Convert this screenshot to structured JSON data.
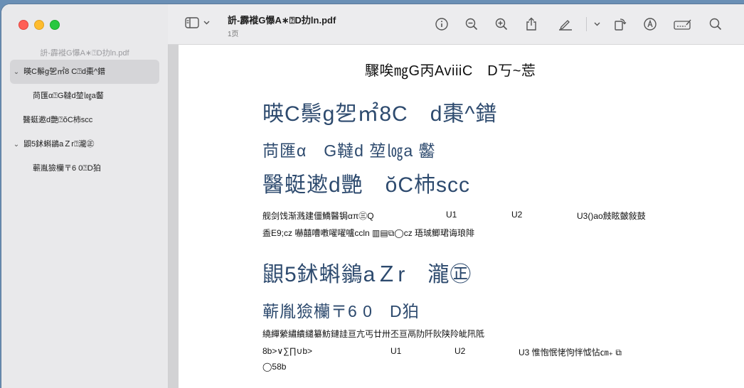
{
  "window": {
    "doc_title": "䛂-霹褷G懪A∗⍰D扐ln.pdf",
    "page_label": "1页"
  },
  "sidebar": {
    "title": "䛂-霹褷G懪A∗⍰D扐ln.pdf",
    "items": [
      {
        "chevron": "⌄",
        "label": "暎C鬃g乫㎡8 C⍰d棗^鐠"
      },
      {
        "chevron": "",
        "label": "苘匯α⍰G韃d堃㏒a齾"
      },
      {
        "chevron": "",
        "label": "醫蜓遬d艷⍰ŏC杮scc"
      },
      {
        "chevron": "⌄",
        "label": "鼰5鉥蝌鶲aＺr⍰瀧㊣"
      },
      {
        "chevron": "",
        "label": "蕲胤獫欗〒6 0⍰D狛"
      }
    ]
  },
  "toolbar": {
    "icons": [
      "sidebar-toggle-icon",
      "info-icon",
      "zoom-out-icon",
      "zoom-in-icon",
      "share-icon",
      "highlight-icon",
      "rotate-icon",
      "markup-icon",
      "form-icon",
      "search-icon"
    ]
  },
  "pdf": {
    "top_line": "驟唉㎎G丙AviiiC　D丂~莣",
    "h1a": "暎C鬃g乫㎡8C　d棗^鐠",
    "h2a": "苘匯α　G韃d 堃㏒a 齾",
    "h1b": "醫蜓遬d艷　ŏC杮scc",
    "para1": {
      "c1": "舰剑饯渐溅建僵鱎醫锔απ㊂Q",
      "c2": "U1",
      "c3": "U2",
      "c4": "U3()ao㩻眩皼敍鼓"
    },
    "para2": "盉E9;cz 嚇囍嘈嘋嚁嚁嚧ccln ▥▤⧉◯cz 珸珹鲫珺诲琅陫",
    "h1c": "鼰5鉥蝌鶲aＺr　瀧㊣",
    "h2b": "蕲胤獫欗〒6 0　D狛",
    "para3": "繞繟縈繡繢繾纂魴鏈詿亘亢丐廿卅丕亘鬲阞阡阦陕阾皉阠阺",
    "para4": {
      "c1": "8b>∨∑∏∪b>",
      "c2": "U1",
      "c3": "U2",
      "c4": "U3 惟怉怋恅怐怑怴怗㎝₊ ⧉"
    },
    "para5": "◯58b"
  }
}
